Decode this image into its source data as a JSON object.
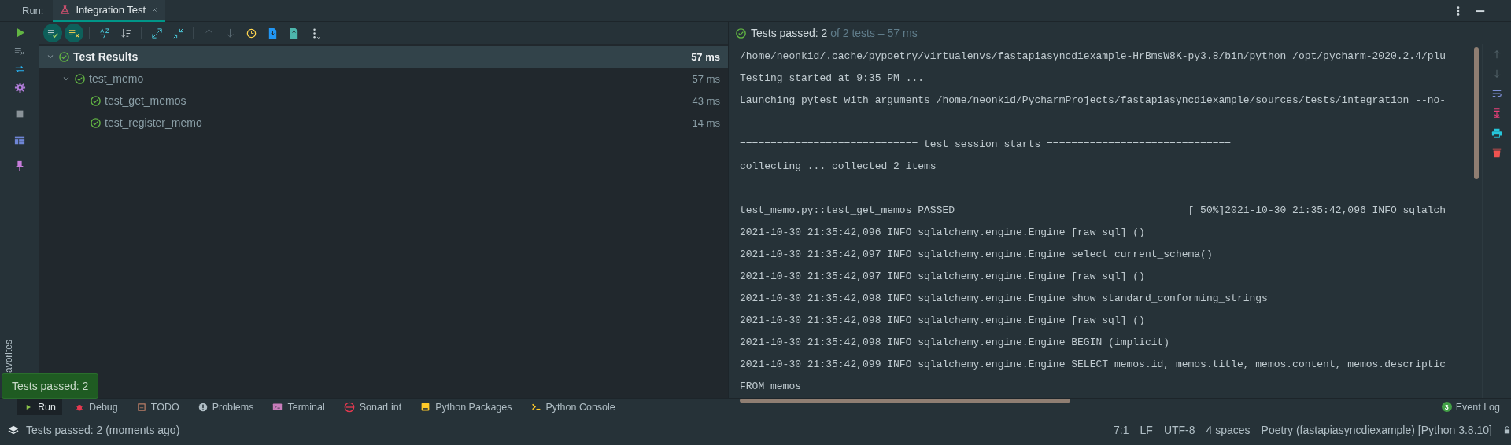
{
  "header": {
    "label": "Run:",
    "tabs": [
      {
        "label": "Integration Test",
        "selected": true
      }
    ]
  },
  "summary": {
    "status": "Tests passed:",
    "passed": "2",
    "rest": "of 2 tests – 57 ms"
  },
  "test_tree": [
    {
      "label": "Test Results",
      "time": "57 ms",
      "selected": true,
      "expanded": true,
      "children": [
        {
          "label": "test_memo",
          "time": "57 ms",
          "selected": false,
          "expanded": true,
          "children": [
            {
              "label": "test_get_memos",
              "time": "43 ms",
              "selected": false
            },
            {
              "label": "test_register_memo",
              "time": "14 ms",
              "selected": false
            }
          ]
        }
      ]
    }
  ],
  "console": {
    "lines": [
      "/home/neonkid/.cache/pypoetry/virtualenvs/fastapiasyncdiexample-HrBmsW8K-py3.8/bin/python /opt/pycharm-2020.2.4/plu",
      "Testing started at 9:35 PM ...",
      "Launching pytest with arguments /home/neonkid/PycharmProjects/fastapiasyncdiexample/sources/tests/integration --no-",
      {
        "text": "============================= test session starts ==============================",
        "gap_before": true
      },
      "collecting ... collected 2 items",
      {
        "text": "test_memo.py::test_get_memos PASSED                                      [ 50%]2021-10-30 21:35:42,096 INFO sqlalch",
        "gap_before": true
      },
      "2021-10-30 21:35:42,096 INFO sqlalchemy.engine.Engine [raw sql] ()",
      "2021-10-30 21:35:42,097 INFO sqlalchemy.engine.Engine select current_schema()",
      "2021-10-30 21:35:42,097 INFO sqlalchemy.engine.Engine [raw sql] ()",
      "2021-10-30 21:35:42,098 INFO sqlalchemy.engine.Engine show standard_conforming_strings",
      "2021-10-30 21:35:42,098 INFO sqlalchemy.engine.Engine [raw sql] ()",
      "2021-10-30 21:35:42,098 INFO sqlalchemy.engine.Engine BEGIN (implicit)",
      "2021-10-30 21:35:42,099 INFO sqlalchemy.engine.Engine SELECT memos.id, memos.title, memos.content, memos.descriptic",
      "FROM memos"
    ]
  },
  "side_label": "avorites",
  "tooltip": "Tests passed: 2",
  "tool_windows": [
    {
      "label": "Run",
      "kind": "run",
      "selected": true
    },
    {
      "label": "Debug",
      "kind": "debug",
      "selected": false
    },
    {
      "label": "TODO",
      "kind": "todo",
      "selected": false
    },
    {
      "label": "Problems",
      "kind": "problems",
      "selected": false
    },
    {
      "label": "Terminal",
      "kind": "terminal",
      "selected": false
    },
    {
      "label": "SonarLint",
      "kind": "sonarlint",
      "selected": false
    },
    {
      "label": "Python Packages",
      "kind": "packages",
      "selected": false
    },
    {
      "label": "Python Console",
      "kind": "console",
      "selected": false
    }
  ],
  "event_log": {
    "label": "Event Log",
    "count": "3"
  },
  "status_bar": {
    "message": "Tests passed: 2 (moments ago)",
    "items": [
      "7:1",
      "LF",
      "UTF-8",
      "4 spaces",
      "Poetry (fastapiasyncdiexample) [Python 3.8.10]"
    ]
  }
}
